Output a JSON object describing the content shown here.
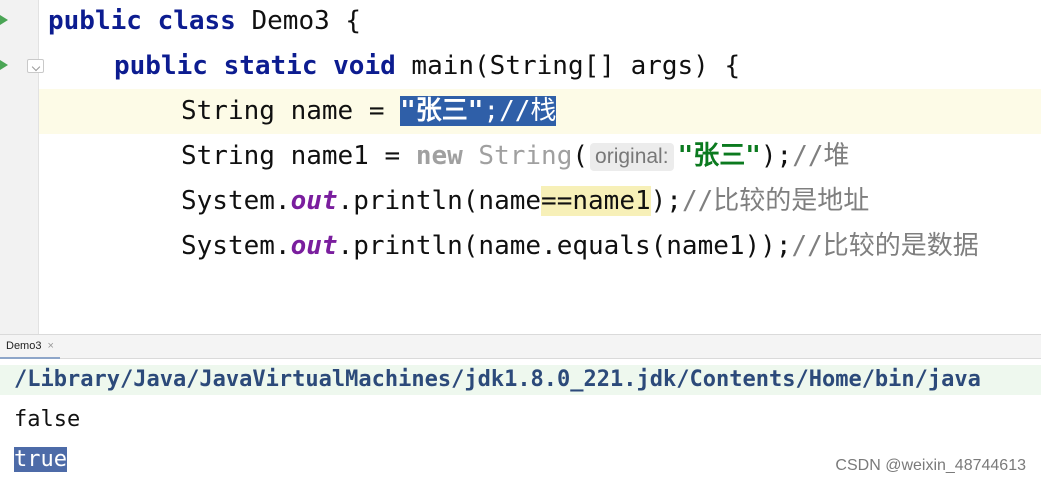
{
  "editor": {
    "line1": {
      "kw": "public class",
      "rest": " Demo3 {"
    },
    "line2": {
      "kw": "public static void",
      "rest": " main(String[] args) {"
    },
    "line3": {
      "pre": "String name = ",
      "sel_str": "\"张三\"",
      "sel_cmt": ";//栈"
    },
    "line4": {
      "pre": "String name1 = ",
      "gray_new": "new",
      "gray_cls": " String",
      "paren": "(",
      "hint": "original:",
      "str": "\"张三\"",
      "post": ");",
      "cmt": "//堆"
    },
    "line5": {
      "obj": "System.",
      "field": "out",
      "call": ".println(name",
      "match": "==name1",
      "close": ");",
      "cmt": "//比较的是地址"
    },
    "line6": {
      "obj": "System.",
      "field": "out",
      "call": ".println(name.equals(name1));",
      "cmt": "//比较的是数据"
    }
  },
  "run": {
    "tab_label": "Demo3",
    "tab_close": "×",
    "command": "/Library/Java/JavaVirtualMachines/jdk1.8.0_221.jdk/Contents/Home/bin/java",
    "output1": "false",
    "output2": "true"
  },
  "watermark": "CSDN @weixin_48744613",
  "colors": {
    "keyword": "#0c1c90",
    "string": "#0b7a1f",
    "field": "#7a1e9e",
    "selection": "#2f5fa8",
    "run_icon": "#4aa555"
  }
}
